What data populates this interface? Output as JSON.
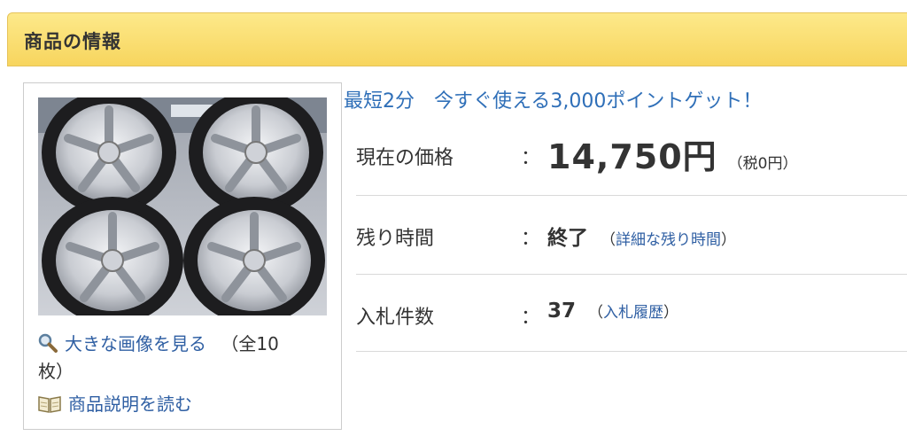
{
  "header": {
    "title": "商品の情報"
  },
  "gallery": {
    "view_large_label": "大きな画像を見る",
    "count_prefix": "（全10",
    "count_suffix": "枚）",
    "description_label": "商品説明を読む"
  },
  "promo": {
    "text": "最短2分　今すぐ使える3,000ポイントゲット！"
  },
  "details": {
    "price": {
      "label": "現在の価格",
      "colon": "：",
      "value": "14,750円",
      "tax_note": "（税0円）"
    },
    "time_left": {
      "label": "残り時間",
      "colon": "：",
      "value": "終了",
      "paren_open": "（",
      "link": "詳細な残り時間",
      "paren_close": "）"
    },
    "bids": {
      "label": "入札件数",
      "colon": "：",
      "value": "37",
      "paren_open": "（",
      "link": "入札履歴",
      "paren_close": "）"
    }
  },
  "colors": {
    "header_bg": "#f7d55e",
    "link": "#2f5fa3",
    "promo": "#2f6fb8",
    "text": "#333333",
    "divider": "#d9d9d9"
  },
  "icons": {
    "magnifier": "magnifier-icon",
    "book": "book-icon"
  }
}
